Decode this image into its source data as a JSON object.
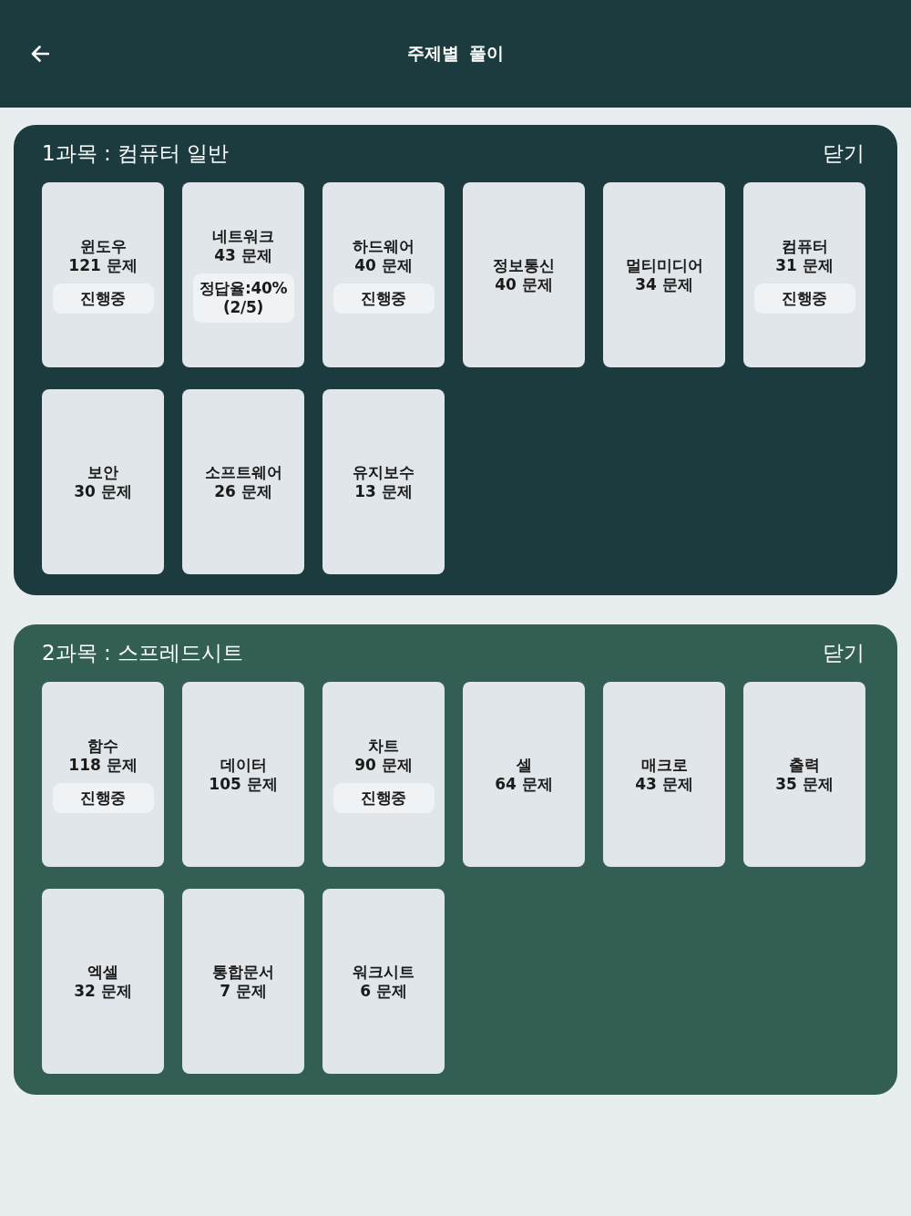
{
  "header": {
    "title": "주제별 풀이"
  },
  "subjects": [
    {
      "title": "1과목 : 컴퓨터 일반",
      "close_label": "닫기",
      "color": "#1b3b3e",
      "topics": [
        {
          "name": "윈도우",
          "count": "121 문제",
          "badge_lines": [
            "진행중"
          ]
        },
        {
          "name": "네트워크",
          "count": "43 문제",
          "badge_lines": [
            "정답율:40%",
            "(2/5)"
          ]
        },
        {
          "name": "하드웨어",
          "count": "40 문제",
          "badge_lines": [
            "진행중"
          ]
        },
        {
          "name": "정보통신",
          "count": "40 문제"
        },
        {
          "name": "멀티미디어",
          "count": "34 문제"
        },
        {
          "name": "컴퓨터",
          "count": "31 문제",
          "badge_lines": [
            "진행중"
          ]
        },
        {
          "name": "보안",
          "count": "30 문제"
        },
        {
          "name": "소프트웨어",
          "count": "26 문제"
        },
        {
          "name": "유지보수",
          "count": "13 문제"
        }
      ]
    },
    {
      "title": "2과목 : 스프레드시트",
      "close_label": "닫기",
      "color": "#325e54",
      "topics": [
        {
          "name": "함수",
          "count": "118 문제",
          "badge_lines": [
            "진행중"
          ]
        },
        {
          "name": "데이터",
          "count": "105 문제"
        },
        {
          "name": "차트",
          "count": "90 문제",
          "badge_lines": [
            "진행중"
          ]
        },
        {
          "name": "셀",
          "count": "64 문제"
        },
        {
          "name": "매크로",
          "count": "43 문제"
        },
        {
          "name": "출력",
          "count": "35 문제"
        },
        {
          "name": "엑셀",
          "count": "32 문제"
        },
        {
          "name": "통합문서",
          "count": "7 문제"
        },
        {
          "name": "워크시트",
          "count": "6 문제"
        }
      ]
    }
  ]
}
